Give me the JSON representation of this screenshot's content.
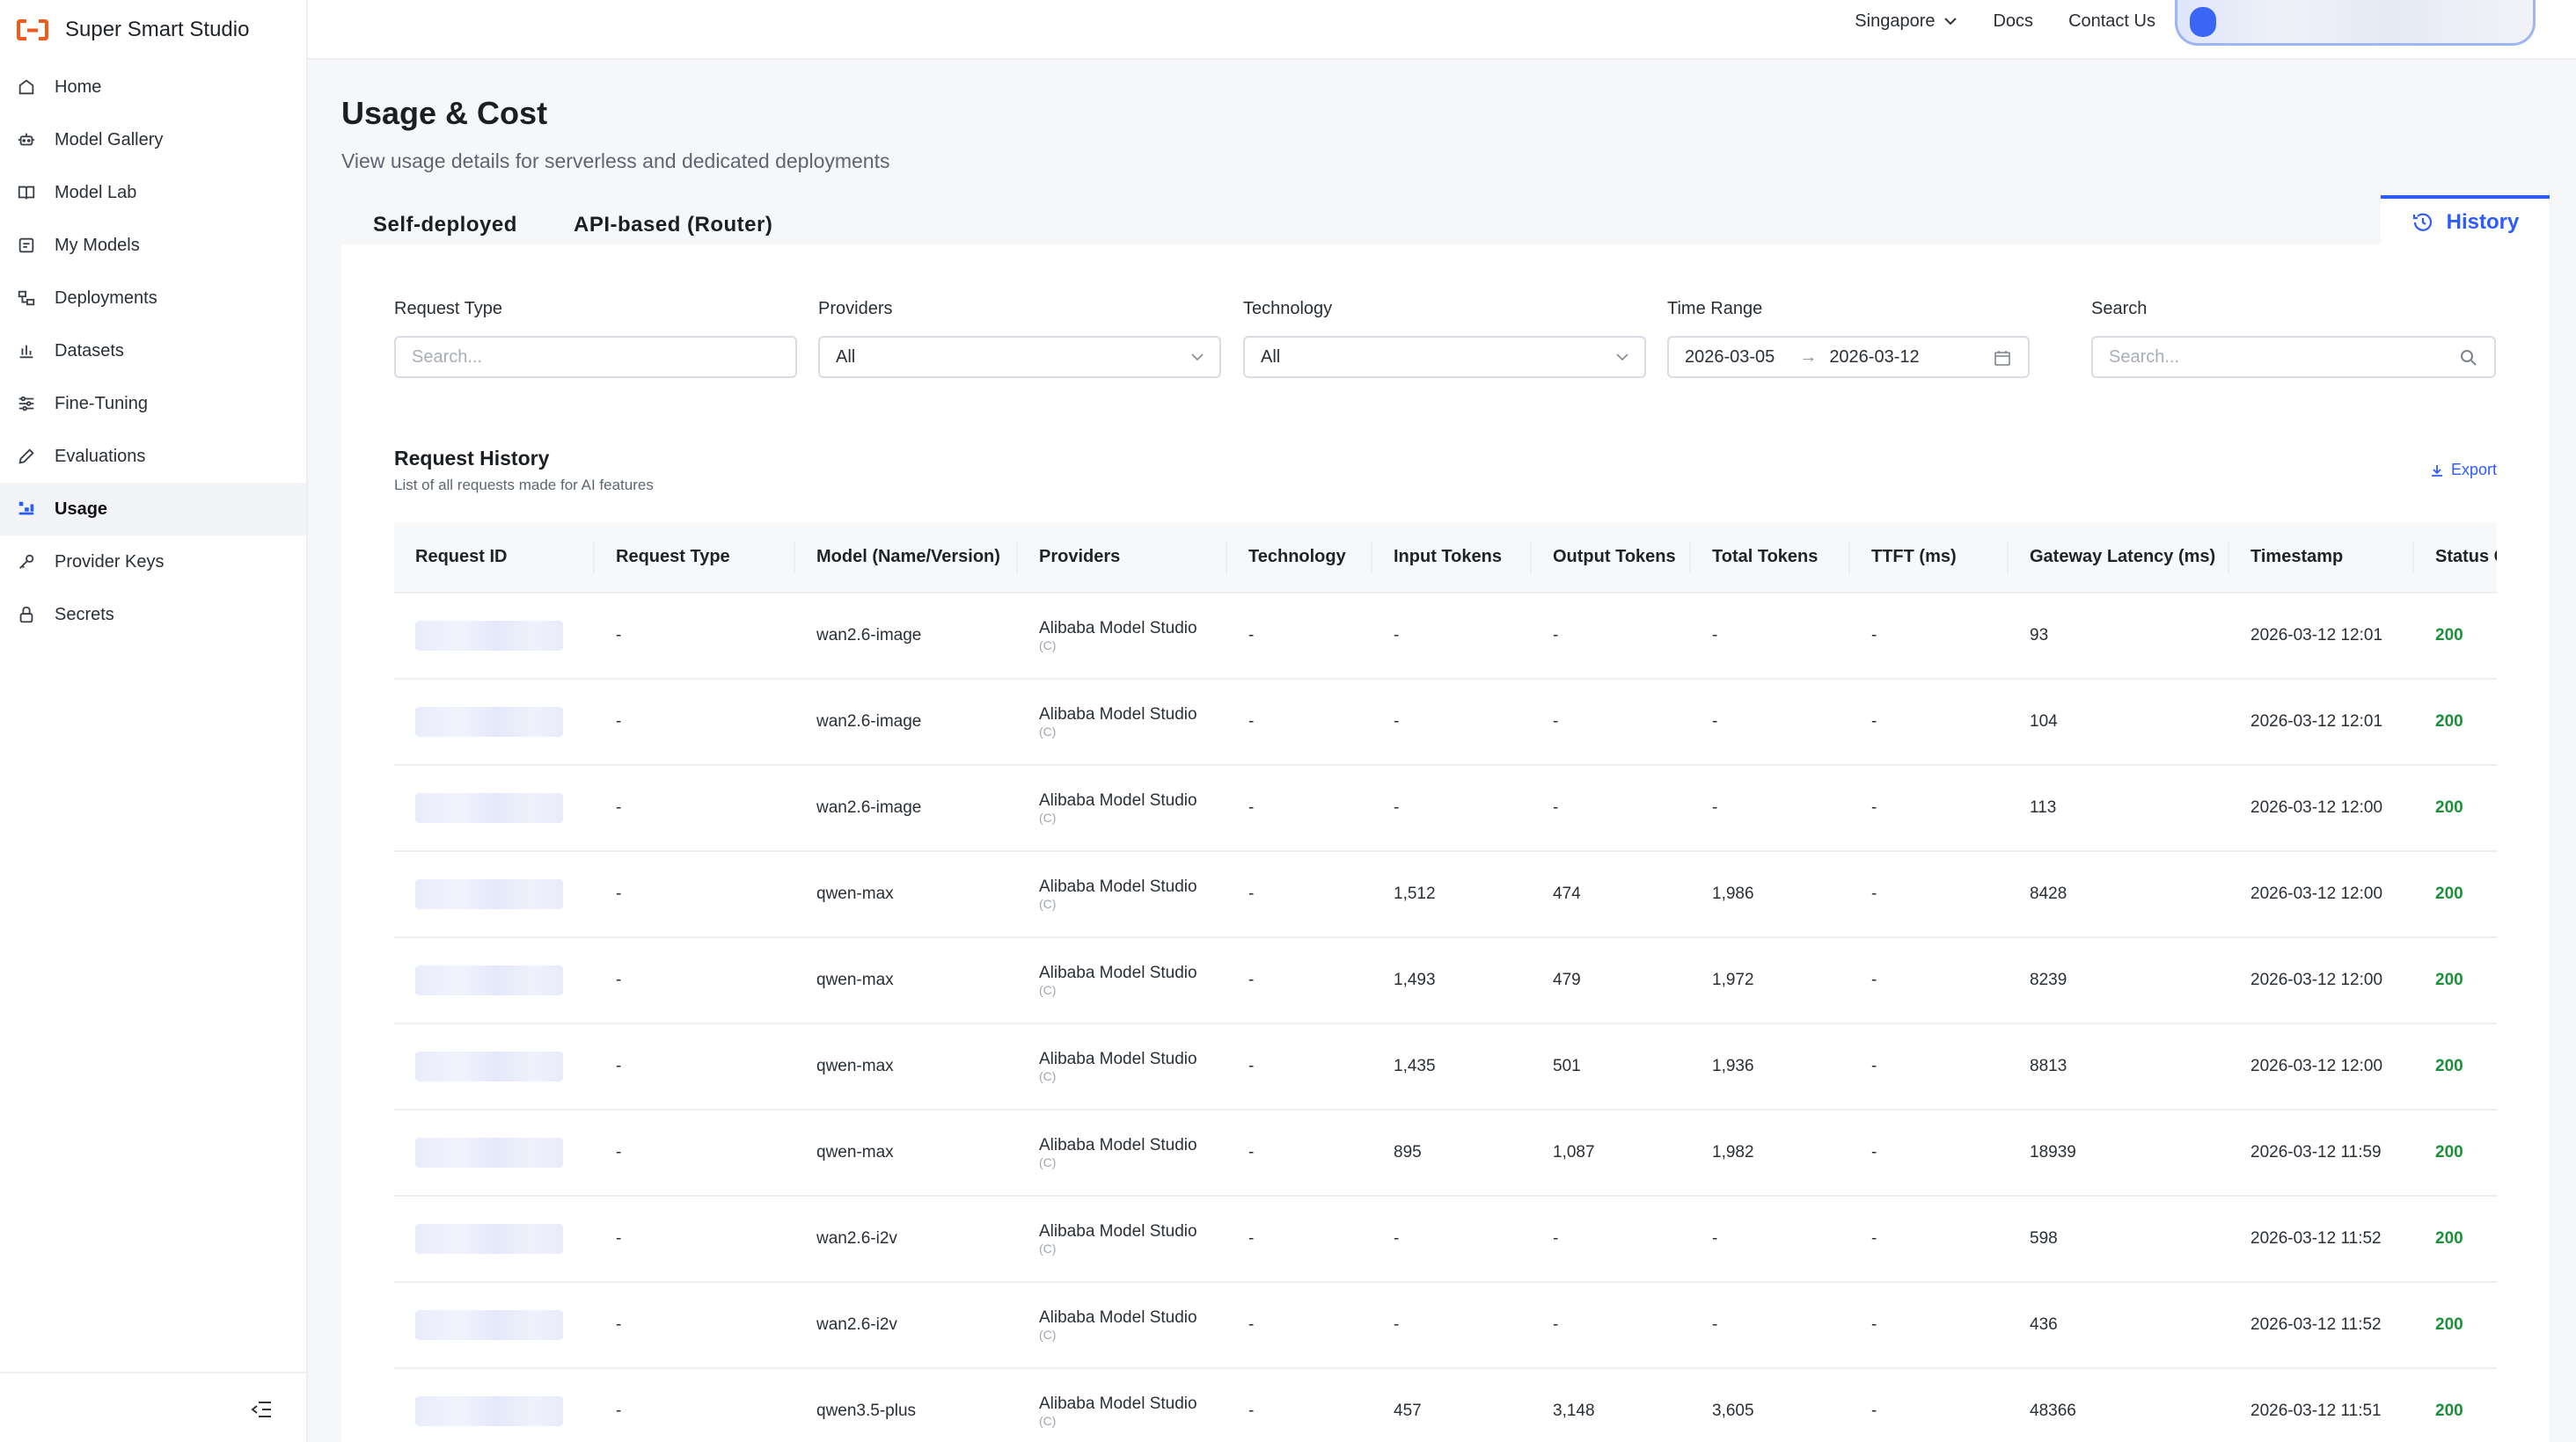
{
  "brand": {
    "name": "Super Smart Studio"
  },
  "sidebar": {
    "items": [
      {
        "label": "Home",
        "icon": "home-icon"
      },
      {
        "label": "Model Gallery",
        "icon": "robot-icon"
      },
      {
        "label": "Model Lab",
        "icon": "book-icon"
      },
      {
        "label": "My Models",
        "icon": "model-icon"
      },
      {
        "label": "Deployments",
        "icon": "deploy-icon"
      },
      {
        "label": "Datasets",
        "icon": "chart-icon"
      },
      {
        "label": "Fine-Tuning",
        "icon": "sliders-icon"
      },
      {
        "label": "Evaluations",
        "icon": "pencil-icon"
      },
      {
        "label": "Usage",
        "icon": "usage-icon",
        "active": true
      },
      {
        "label": "Provider Keys",
        "icon": "key-icon"
      },
      {
        "label": "Secrets",
        "icon": "lock-icon"
      }
    ]
  },
  "topbar": {
    "region": "Singapore",
    "docs": "Docs",
    "contact": "Contact Us"
  },
  "page": {
    "title": "Usage & Cost",
    "subtitle": "View usage details for serverless and dedicated deployments"
  },
  "tabs": {
    "self": "Self-deployed",
    "api": "API-based (Router)",
    "history": "History"
  },
  "filters": {
    "request_type": {
      "label": "Request Type",
      "placeholder": "Search..."
    },
    "providers": {
      "label": "Providers",
      "value": "All"
    },
    "technology": {
      "label": "Technology",
      "value": "All"
    },
    "time_range": {
      "label": "Time Range",
      "start": "2026-03-05",
      "end": "2026-03-12"
    },
    "search": {
      "label": "Search",
      "placeholder": "Search..."
    }
  },
  "history": {
    "title": "Request History",
    "subtitle": "List of all requests made for AI features",
    "export": "Export"
  },
  "table": {
    "columns": [
      "Request ID",
      "Request Type",
      "Model (Name/Version)",
      "Providers",
      "Technology",
      "Input Tokens",
      "Output Tokens",
      "Total Tokens",
      "TTFT (ms)",
      "Gateway Latency (ms)",
      "Timestamp",
      "Status Code"
    ],
    "rows": [
      {
        "type": "-",
        "model": "wan2.6-image",
        "provider": "Alibaba Model Studio",
        "provider_sub": "(C)",
        "tech": "-",
        "input": "-",
        "output": "-",
        "total": "-",
        "ttft": "-",
        "latency": "93",
        "timestamp": "2026-03-12 12:01",
        "status": "200"
      },
      {
        "type": "-",
        "model": "wan2.6-image",
        "provider": "Alibaba Model Studio",
        "provider_sub": "(C)",
        "tech": "-",
        "input": "-",
        "output": "-",
        "total": "-",
        "ttft": "-",
        "latency": "104",
        "timestamp": "2026-03-12 12:01",
        "status": "200"
      },
      {
        "type": "-",
        "model": "wan2.6-image",
        "provider": "Alibaba Model Studio",
        "provider_sub": "(C)",
        "tech": "-",
        "input": "-",
        "output": "-",
        "total": "-",
        "ttft": "-",
        "latency": "113",
        "timestamp": "2026-03-12 12:00",
        "status": "200"
      },
      {
        "type": "-",
        "model": "qwen-max",
        "provider": "Alibaba Model Studio",
        "provider_sub": "(C)",
        "tech": "-",
        "input": "1,512",
        "output": "474",
        "total": "1,986",
        "ttft": "-",
        "latency": "8428",
        "timestamp": "2026-03-12 12:00",
        "status": "200"
      },
      {
        "type": "-",
        "model": "qwen-max",
        "provider": "Alibaba Model Studio",
        "provider_sub": "(C)",
        "tech": "-",
        "input": "1,493",
        "output": "479",
        "total": "1,972",
        "ttft": "-",
        "latency": "8239",
        "timestamp": "2026-03-12 12:00",
        "status": "200"
      },
      {
        "type": "-",
        "model": "qwen-max",
        "provider": "Alibaba Model Studio",
        "provider_sub": "(C)",
        "tech": "-",
        "input": "1,435",
        "output": "501",
        "total": "1,936",
        "ttft": "-",
        "latency": "8813",
        "timestamp": "2026-03-12 12:00",
        "status": "200"
      },
      {
        "type": "-",
        "model": "qwen-max",
        "provider": "Alibaba Model Studio",
        "provider_sub": "(C)",
        "tech": "-",
        "input": "895",
        "output": "1,087",
        "total": "1,982",
        "ttft": "-",
        "latency": "18939",
        "timestamp": "2026-03-12 11:59",
        "status": "200"
      },
      {
        "type": "-",
        "model": "wan2.6-i2v",
        "provider": "Alibaba Model Studio",
        "provider_sub": "(C)",
        "tech": "-",
        "input": "-",
        "output": "-",
        "total": "-",
        "ttft": "-",
        "latency": "598",
        "timestamp": "2026-03-12 11:52",
        "status": "200"
      },
      {
        "type": "-",
        "model": "wan2.6-i2v",
        "provider": "Alibaba Model Studio",
        "provider_sub": "(C)",
        "tech": "-",
        "input": "-",
        "output": "-",
        "total": "-",
        "ttft": "-",
        "latency": "436",
        "timestamp": "2026-03-12 11:52",
        "status": "200"
      },
      {
        "type": "-",
        "model": "qwen3.5-plus",
        "provider": "Alibaba Model Studio",
        "provider_sub": "(C)",
        "tech": "-",
        "input": "457",
        "output": "3,148",
        "total": "3,605",
        "ttft": "-",
        "latency": "48366",
        "timestamp": "2026-03-12 11:51",
        "status": "200"
      }
    ]
  },
  "colors": {
    "accent": "#2e5bff",
    "status_ok": "#1c8f3a",
    "logo": "#f05a1a"
  }
}
